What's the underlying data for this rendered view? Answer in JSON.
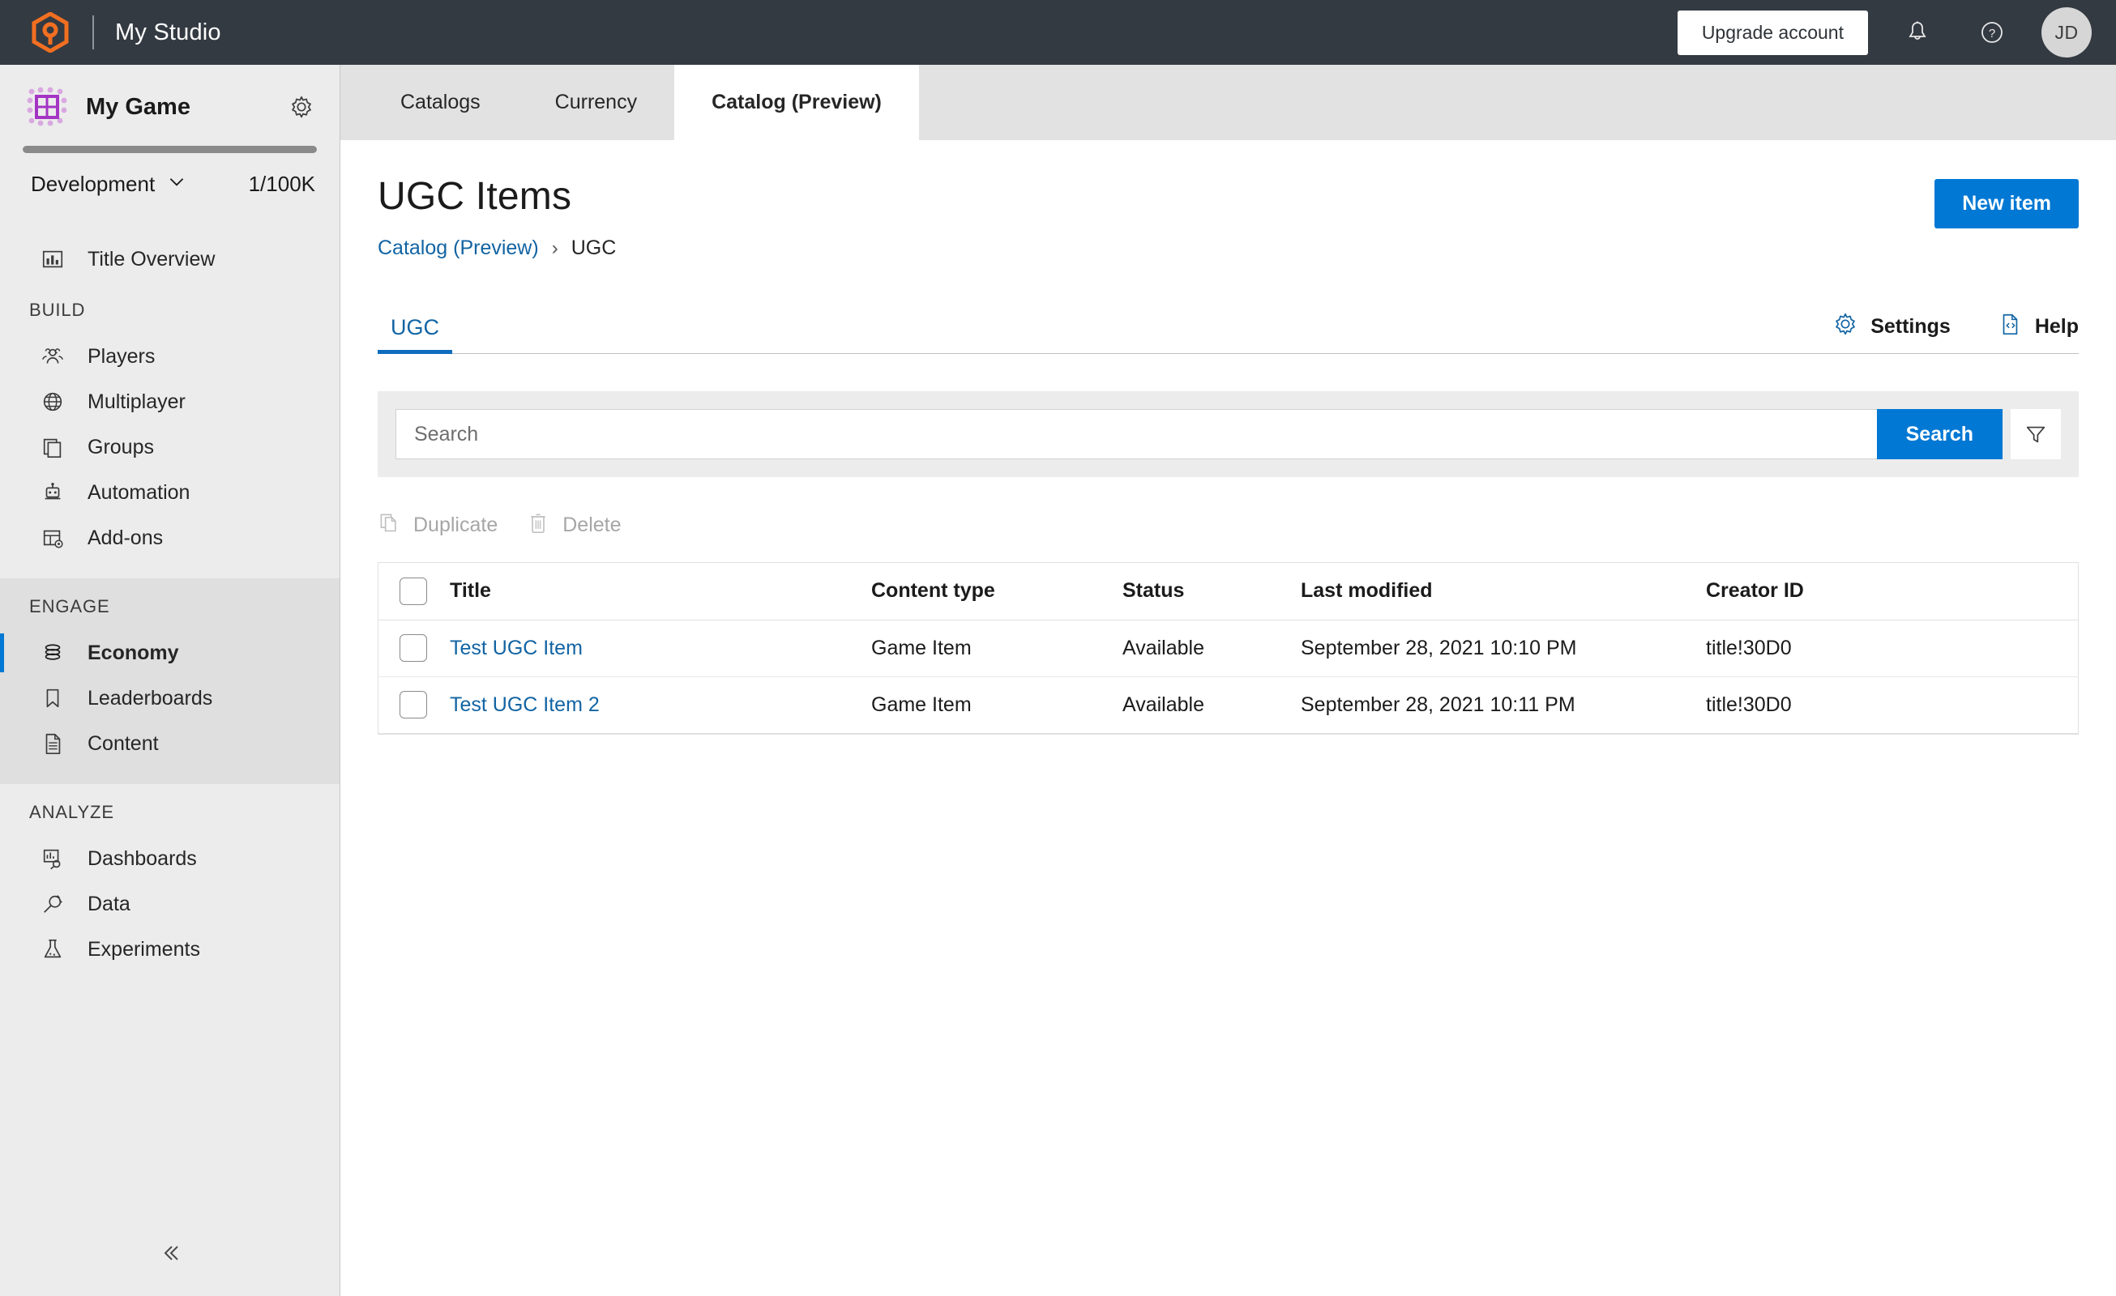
{
  "topbar": {
    "logo_icon": "playfab-hexagon-logo",
    "studio_title": "My Studio",
    "upgrade_label": "Upgrade account",
    "bell_icon": "notification-bell-icon",
    "help_icon": "help-question-icon",
    "avatar_initials": "JD",
    "accent": "#f26f21",
    "background": "#343a42"
  },
  "sidebar": {
    "game_icon": "game-grid-icon",
    "game_name": "My Game",
    "gear_icon": "gear-icon",
    "progress_percent": 100,
    "environment": "Development",
    "environment_chevron": "chevron-down-icon",
    "quota": "1/100K",
    "overview": {
      "label": "Title Overview",
      "icon": "bar-chart-icon"
    },
    "groups": [
      {
        "label": "BUILD",
        "active": false,
        "items": [
          {
            "label": "Players",
            "icon": "people-icon",
            "selected": false
          },
          {
            "label": "Multiplayer",
            "icon": "globe-icon",
            "selected": false
          },
          {
            "label": "Groups",
            "icon": "stacked-pages-icon",
            "selected": false
          },
          {
            "label": "Automation",
            "icon": "robot-icon",
            "selected": false
          },
          {
            "label": "Add-ons",
            "icon": "table-gear-icon",
            "selected": false
          }
        ]
      },
      {
        "label": "ENGAGE",
        "active": true,
        "items": [
          {
            "label": "Economy",
            "icon": "coins-stack-icon",
            "selected": true
          },
          {
            "label": "Leaderboards",
            "icon": "bookmark-icon",
            "selected": false
          },
          {
            "label": "Content",
            "icon": "document-lines-icon",
            "selected": false
          }
        ]
      },
      {
        "label": "ANALYZE",
        "active": false,
        "items": [
          {
            "label": "Dashboards",
            "icon": "chart-magnifier-icon",
            "selected": false
          },
          {
            "label": "Data",
            "icon": "plug-icon",
            "selected": false
          },
          {
            "label": "Experiments",
            "icon": "flask-icon",
            "selected": false
          }
        ]
      }
    ],
    "collapse_icon": "double-chevron-left-icon",
    "selected_accent": "#0078d4"
  },
  "tabs": [
    {
      "label": "Catalogs",
      "active": false
    },
    {
      "label": "Currency",
      "active": false
    },
    {
      "label": "Catalog (Preview)",
      "active": true
    }
  ],
  "page": {
    "title": "UGC Items",
    "breadcrumb_link": "Catalog (Preview)",
    "breadcrumb_separator": "›",
    "breadcrumb_current": "UGC",
    "new_item_label": "New item",
    "new_item_color": "#0078d4"
  },
  "subnav": {
    "tabs": [
      {
        "label": "UGC",
        "active": true
      }
    ],
    "settings_label": "Settings",
    "settings_icon": "gear-icon",
    "help_label": "Help",
    "help_icon": "code-document-icon"
  },
  "search": {
    "placeholder": "Search",
    "value": "",
    "button_label": "Search",
    "filter_icon": "funnel-filter-icon"
  },
  "row_actions": [
    {
      "label": "Duplicate",
      "icon": "copy-icon",
      "disabled": true
    },
    {
      "label": "Delete",
      "icon": "trash-icon",
      "disabled": true
    }
  ],
  "table": {
    "columns": [
      "Title",
      "Content type",
      "Status",
      "Last modified",
      "Creator ID"
    ],
    "rows": [
      {
        "title": "Test UGC Item",
        "content_type": "Game Item",
        "status": "Available",
        "last_modified": "September 28, 2021 10:10 PM",
        "creator_id": "title!30D0",
        "checked": false
      },
      {
        "title": "Test UGC Item 2",
        "content_type": "Game Item",
        "status": "Available",
        "last_modified": "September 28, 2021 10:11 PM",
        "creator_id": "title!30D0",
        "checked": false
      }
    ]
  }
}
